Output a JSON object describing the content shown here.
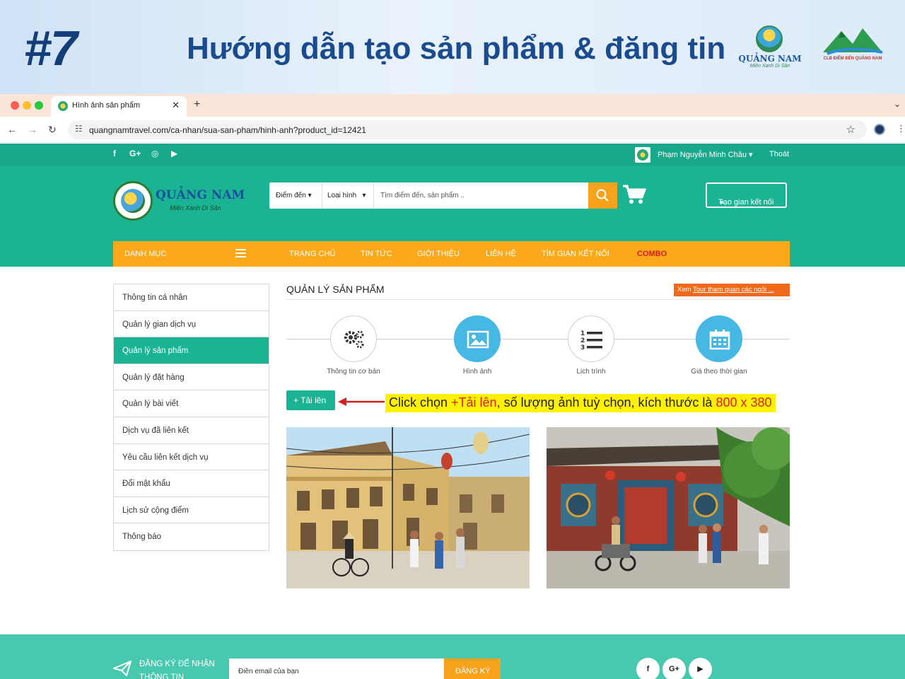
{
  "banner": {
    "number": "#7",
    "title": "Hướng dẫn tạo sản phẩm & đăng tin",
    "logo1_name": "QUẢNG NAM",
    "logo1_slogan": "Miền Xanh Di Sản",
    "logo2_text": "CLB ĐIỂM ĐẾN QUẢNG NAM"
  },
  "browser": {
    "tab_title": "Hình ảnh sản phẩm",
    "url": "quangnamtravel.com/ca-nhan/sua-san-pham/hinh-anh?product_id=12421"
  },
  "topbar": {
    "user_name": "Phạm Nguyễn Minh Châu",
    "logout": "Thoát"
  },
  "header": {
    "site_name": "QUẢNG NAM",
    "site_slogan": "Miền Xanh Di Sản",
    "destination_select": "Điểm đến",
    "type_select": "Loại hình",
    "search_placeholder": "Tìm điểm đến, sản phẩm ..",
    "connect_button": "Tạo gian kết nối"
  },
  "menu": {
    "category": "DANH MỤC",
    "items": [
      "TRANG CHỦ",
      "TIN TỨC",
      "GIỚI THIỆU",
      "LIÊN HỆ",
      "TÌM GIAN KẾT NỐI",
      "COMBO"
    ]
  },
  "sidebar": {
    "items": [
      {
        "label": "Thông tin cá nhân"
      },
      {
        "label": "Quản lý gian dịch vụ"
      },
      {
        "label": "Quản lý sản phẩm"
      },
      {
        "label": "Quản lý đặt hàng"
      },
      {
        "label": "Quản lý bài viết"
      },
      {
        "label": "Dịch vụ đã liên kết"
      },
      {
        "label": "Yêu cầu liên kết dịch vụ"
      },
      {
        "label": "Đổi mật khẩu"
      },
      {
        "label": "Lịch sử cộng điểm"
      },
      {
        "label": "Thông báo"
      }
    ],
    "active_index": 2
  },
  "main": {
    "page_title": "QUẢN LÝ SẢN PHẨM",
    "tour_link_prefix": "Xem",
    "tour_link_text": "Tour tham quan các ngôi ...",
    "steps": [
      {
        "label": "Thông tin cơ bản",
        "icon": "gears-icon"
      },
      {
        "label": "Hình ảnh",
        "icon": "image-icon"
      },
      {
        "label": "Lịch trình",
        "icon": "numbered-list-icon"
      },
      {
        "label": "Giá theo thời gian",
        "icon": "calendar-icon"
      }
    ],
    "upload_button": "Tải lên",
    "instruction": {
      "part1": "Click chọn ",
      "part2": "+Tải lên",
      "part3": ", số lượng ảnh tuỳ chọn, kích thước là ",
      "part4": "800 x 380"
    }
  },
  "footer": {
    "subscribe_line1": "ĐĂNG KÝ ĐỂ NHẬN",
    "subscribe_line2": "THÔNG TIN",
    "email_placeholder": "Điền email của bạn",
    "subscribe_button": "ĐĂNG KÝ"
  },
  "colors": {
    "brand_green": "#1ab394",
    "menu_orange": "#fba81a",
    "title_blue": "#1b4b8f",
    "step_active_blue": "#47b7e4",
    "highlight_yellow": "#fff200",
    "highlight_red": "#e02020"
  }
}
